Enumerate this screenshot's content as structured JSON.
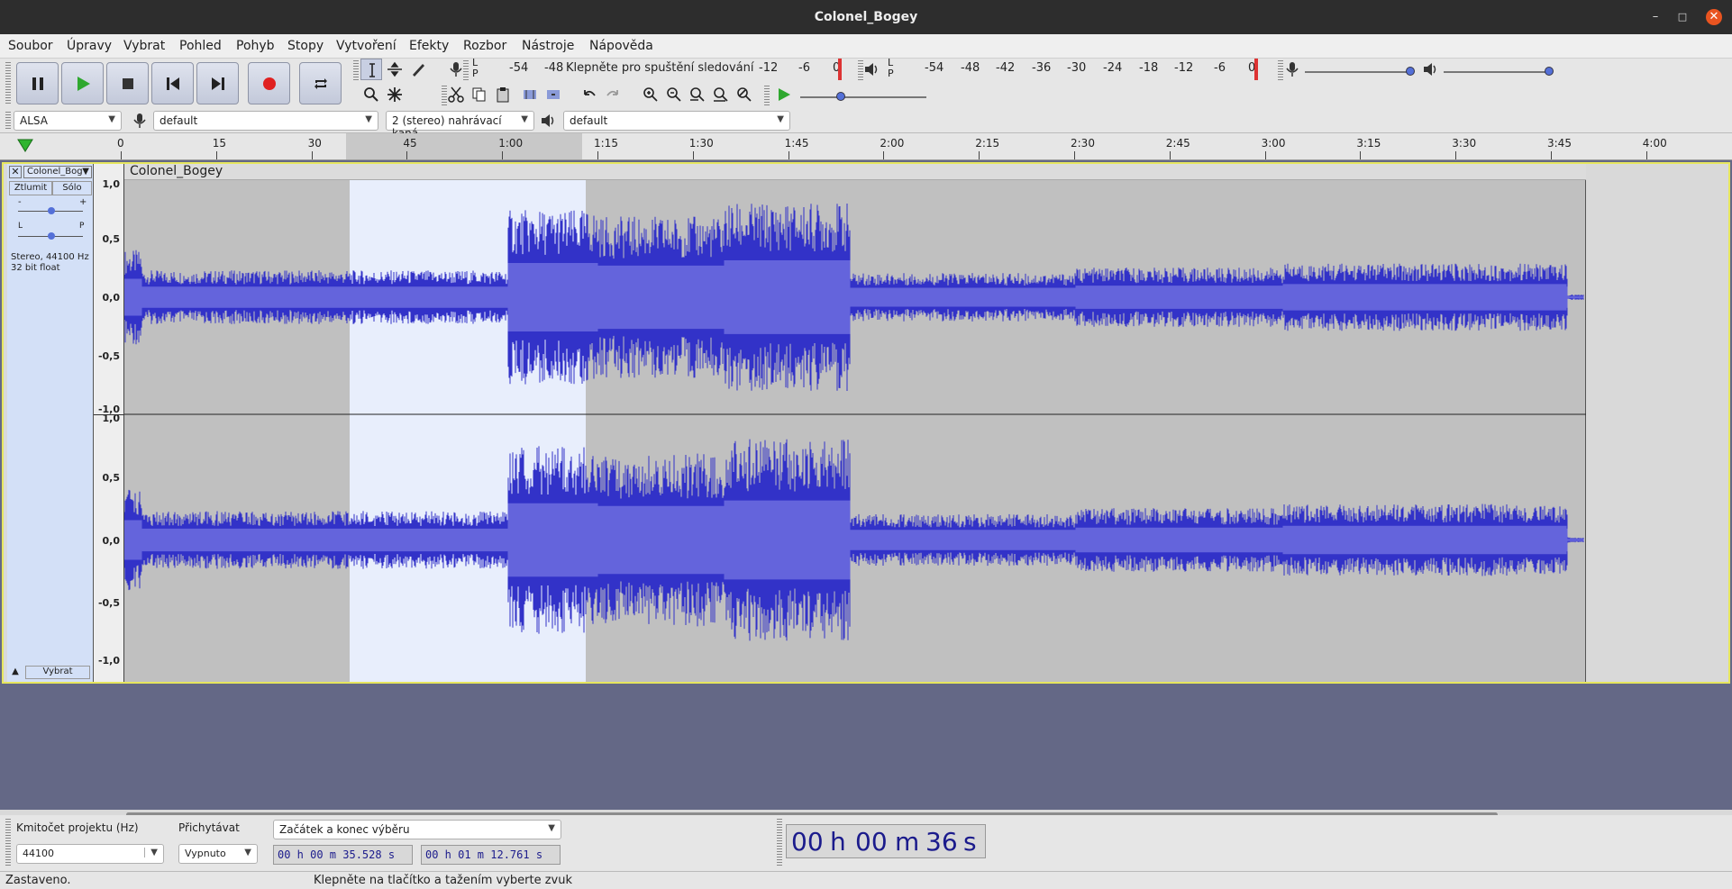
{
  "window": {
    "title": "Colonel_Bogey"
  },
  "menu": [
    "Soubor",
    "Úpravy",
    "Vybrat",
    "Pohled",
    "Pohyb",
    "Stopy",
    "Vytvoření",
    "Efekty",
    "Rozbor",
    "Nástroje",
    "Nápověda"
  ],
  "meters": {
    "record_labels": [
      "L",
      "P"
    ],
    "record_ticks": [
      "-54",
      "-48",
      "Klepněte pro spuštění sledování",
      "-12",
      "-6",
      "0"
    ],
    "play_labels": [
      "L",
      "P"
    ],
    "play_ticks": [
      "-54",
      "-48",
      "-42",
      "-36",
      "-30",
      "-24",
      "-18",
      "-12",
      "-6",
      "0"
    ]
  },
  "devices": {
    "host": "ALSA",
    "recording_device": "default",
    "channels": "2 (stereo) nahrávací kaná",
    "playback_device": "default"
  },
  "ruler": {
    "ticks": [
      "0",
      "15",
      "30",
      "45",
      "1:00",
      "1:15",
      "1:30",
      "1:45",
      "2:00",
      "2:15",
      "2:30",
      "2:45",
      "3:00",
      "3:15",
      "3:30",
      "3:45",
      "4:00"
    ]
  },
  "track": {
    "name": "Colonel_Bog",
    "clip_name": "Colonel_Bogey",
    "mute": "Ztlumit",
    "solo": "Sólo",
    "gain_min": "-",
    "gain_max": "+",
    "pan_left": "L",
    "pan_right": "P",
    "info_line1": "Stereo, 44100 Hz",
    "info_line2": "32 bit float",
    "select": "Vybrat",
    "scale_labels": [
      "1,0",
      "0,5",
      "0,0",
      "-0,5",
      "-1,0"
    ]
  },
  "bottom": {
    "rate_label": "Kmitočet projektu (Hz)",
    "rate_value": "44100",
    "snap_label": "Přichytávat",
    "snap_value": "Vypnuto",
    "selection_mode": "Začátek a konec výběru",
    "sel_start": "00 h 00 m 35.528 s",
    "sel_end": "00 h 01 m 12.761 s",
    "time_display": {
      "h": "00",
      "hu": "h",
      "m": "00",
      "mu": "m",
      "s": "36",
      "su": "s"
    }
  },
  "status": {
    "left": "Zastaveno.",
    "hint": "Klepněte na tlačítko a tažením vyberte zvuk"
  },
  "colors": {
    "waveform": "#3232c8",
    "waveform_rms": "#6464dc",
    "selection": "#e8eefc",
    "track_focus": "#e6e65e"
  }
}
